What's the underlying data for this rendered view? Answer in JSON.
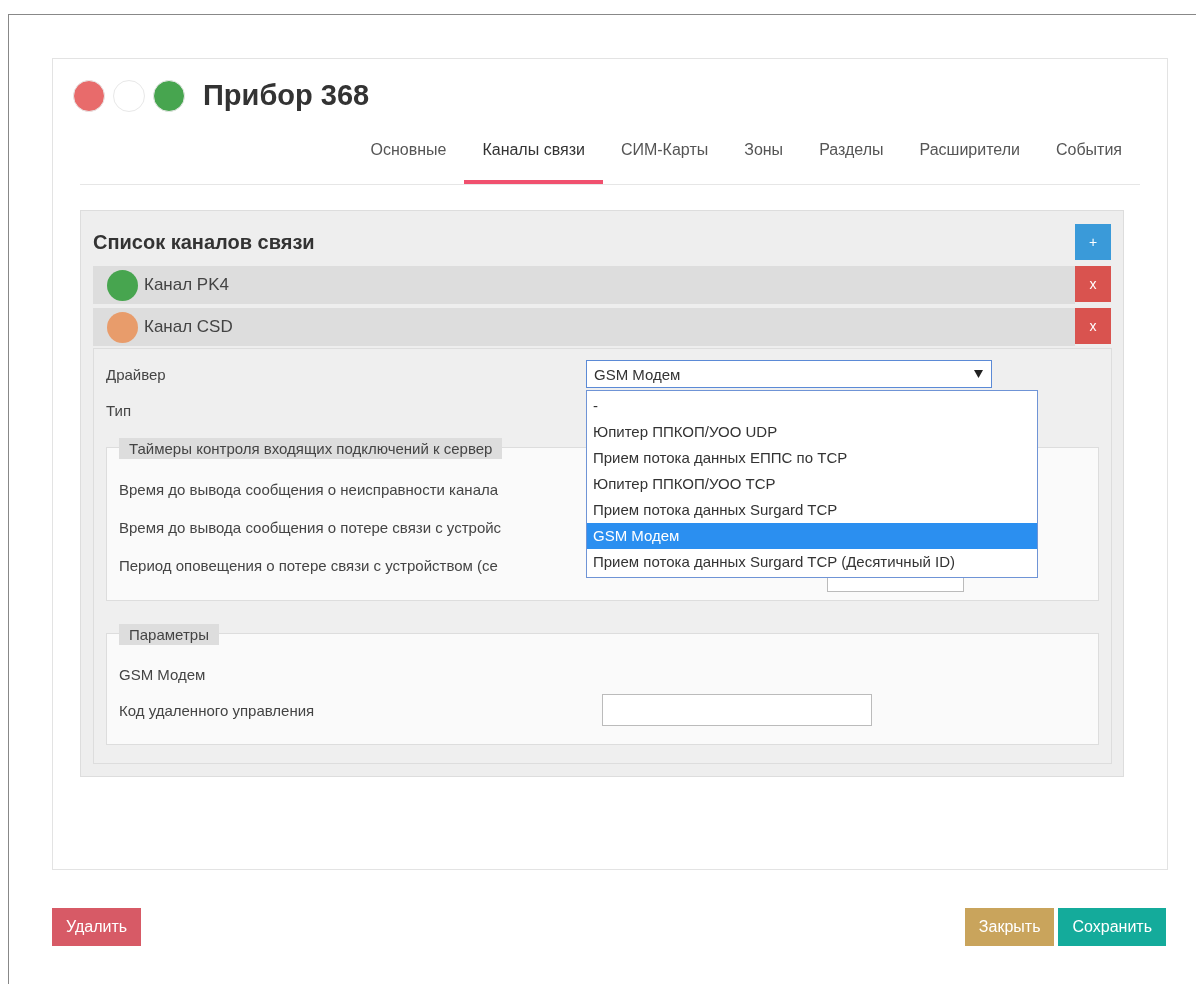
{
  "header": {
    "title": "Прибор 368",
    "status_dots": [
      {
        "color": "#e86b6b"
      },
      {
        "color": "#ffffff"
      },
      {
        "color": "#47a54f"
      }
    ]
  },
  "tabs": [
    {
      "label": "Основные",
      "selected": false
    },
    {
      "label": "Каналы связи",
      "selected": true
    },
    {
      "label": "СИМ-Карты",
      "selected": false
    },
    {
      "label": "Зоны",
      "selected": false
    },
    {
      "label": "Разделы",
      "selected": false
    },
    {
      "label": "Расширители",
      "selected": false
    },
    {
      "label": "События",
      "selected": false
    }
  ],
  "channels_panel": {
    "title": "Список каналов связи",
    "add_button": "+",
    "channels": [
      {
        "name": "Канал PK4",
        "color": "#47a54f",
        "delete_button": "x"
      },
      {
        "name": "Канал CSD",
        "color": "#e89c6b",
        "delete_button": "x"
      }
    ],
    "details": {
      "driver_label": "Драйвер",
      "driver_value": "GSM Модем",
      "type_label": "Тип",
      "driver_options": [
        {
          "label": "-",
          "selected": false
        },
        {
          "label": "Юпитер ППКОП/УОО UDP",
          "selected": false
        },
        {
          "label": "Прием потока данных ЕППС по TCP",
          "selected": false
        },
        {
          "label": "Юпитер ППКОП/УОО TCP",
          "selected": false
        },
        {
          "label": "Прием потока данных Surgard TCP",
          "selected": false
        },
        {
          "label": "GSM Модем",
          "selected": true
        },
        {
          "label": "Прием потока данных Surgard TCP (Десятичный ID)",
          "selected": false
        }
      ],
      "timers": {
        "legend": "Таймеры контроля входящих подключений к сервер",
        "rows": [
          {
            "label": "Время до вывода сообщения о неисправности канала",
            "kind": "label"
          },
          {
            "label": "Время до вывода сообщения о потере связи с устройс",
            "kind": "label"
          },
          {
            "label": "Период оповещения о потере связи с устройством (се",
            "kind": "field"
          }
        ]
      },
      "parameters": {
        "legend": "Параметры",
        "driver_name": "GSM Модем",
        "code_label": "Код удаленного управления"
      }
    }
  },
  "footer": {
    "delete_button": "Удалить",
    "close_button": "Закрыть",
    "save_button": "Сохранить"
  }
}
